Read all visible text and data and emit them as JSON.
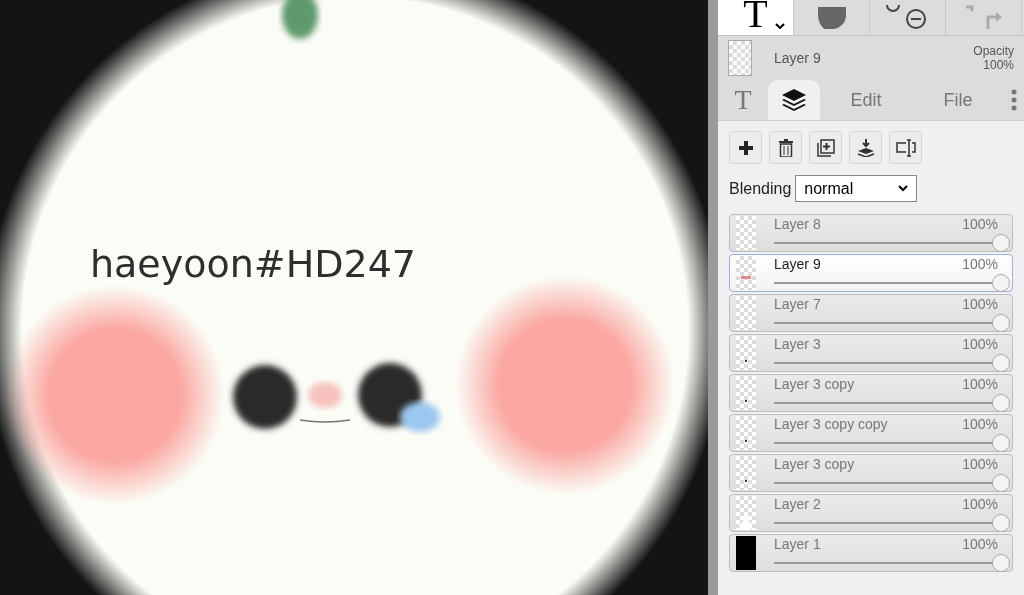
{
  "canvas": {
    "text": "haeyoon#HD247"
  },
  "toolbar": {
    "tool_glyph": "T"
  },
  "current_layer": {
    "name": "Layer 9",
    "opacity_label": "Opacity",
    "opacity": "100%"
  },
  "tabs": [
    {
      "kind": "glyph",
      "label": "T",
      "selected": false
    },
    {
      "kind": "layers",
      "selected": true
    },
    {
      "kind": "text",
      "label": "Edit",
      "selected": false
    },
    {
      "kind": "text",
      "label": "File",
      "selected": false
    },
    {
      "kind": "more",
      "selected": false
    }
  ],
  "blending": {
    "label": "Blending",
    "value": "normal"
  },
  "layers": [
    {
      "name": "Layer 8",
      "opacity": "100%",
      "level": 1,
      "selected": false,
      "kind": "empty"
    },
    {
      "name": "Layer 9",
      "opacity": "100%",
      "level": 1,
      "selected": true,
      "kind": "dots"
    },
    {
      "name": "Layer 7",
      "opacity": "100%",
      "level": 1,
      "selected": false,
      "kind": "empty"
    },
    {
      "name": "Layer 3",
      "opacity": "100%",
      "level": 1,
      "selected": false,
      "kind": "speck"
    },
    {
      "name": "Layer 3 copy",
      "opacity": "100%",
      "level": 1,
      "selected": false,
      "kind": "speck"
    },
    {
      "name": "Layer 3 copy copy",
      "opacity": "100%",
      "level": 1,
      "selected": false,
      "kind": "speck"
    },
    {
      "name": "Layer 3 copy",
      "opacity": "100%",
      "level": 1,
      "selected": false,
      "kind": "speck"
    },
    {
      "name": "Layer 2",
      "opacity": "100%",
      "level": 1,
      "selected": false,
      "kind": "figure"
    },
    {
      "name": "Layer 1",
      "opacity": "100%",
      "level": 1,
      "selected": false,
      "kind": "black"
    }
  ]
}
